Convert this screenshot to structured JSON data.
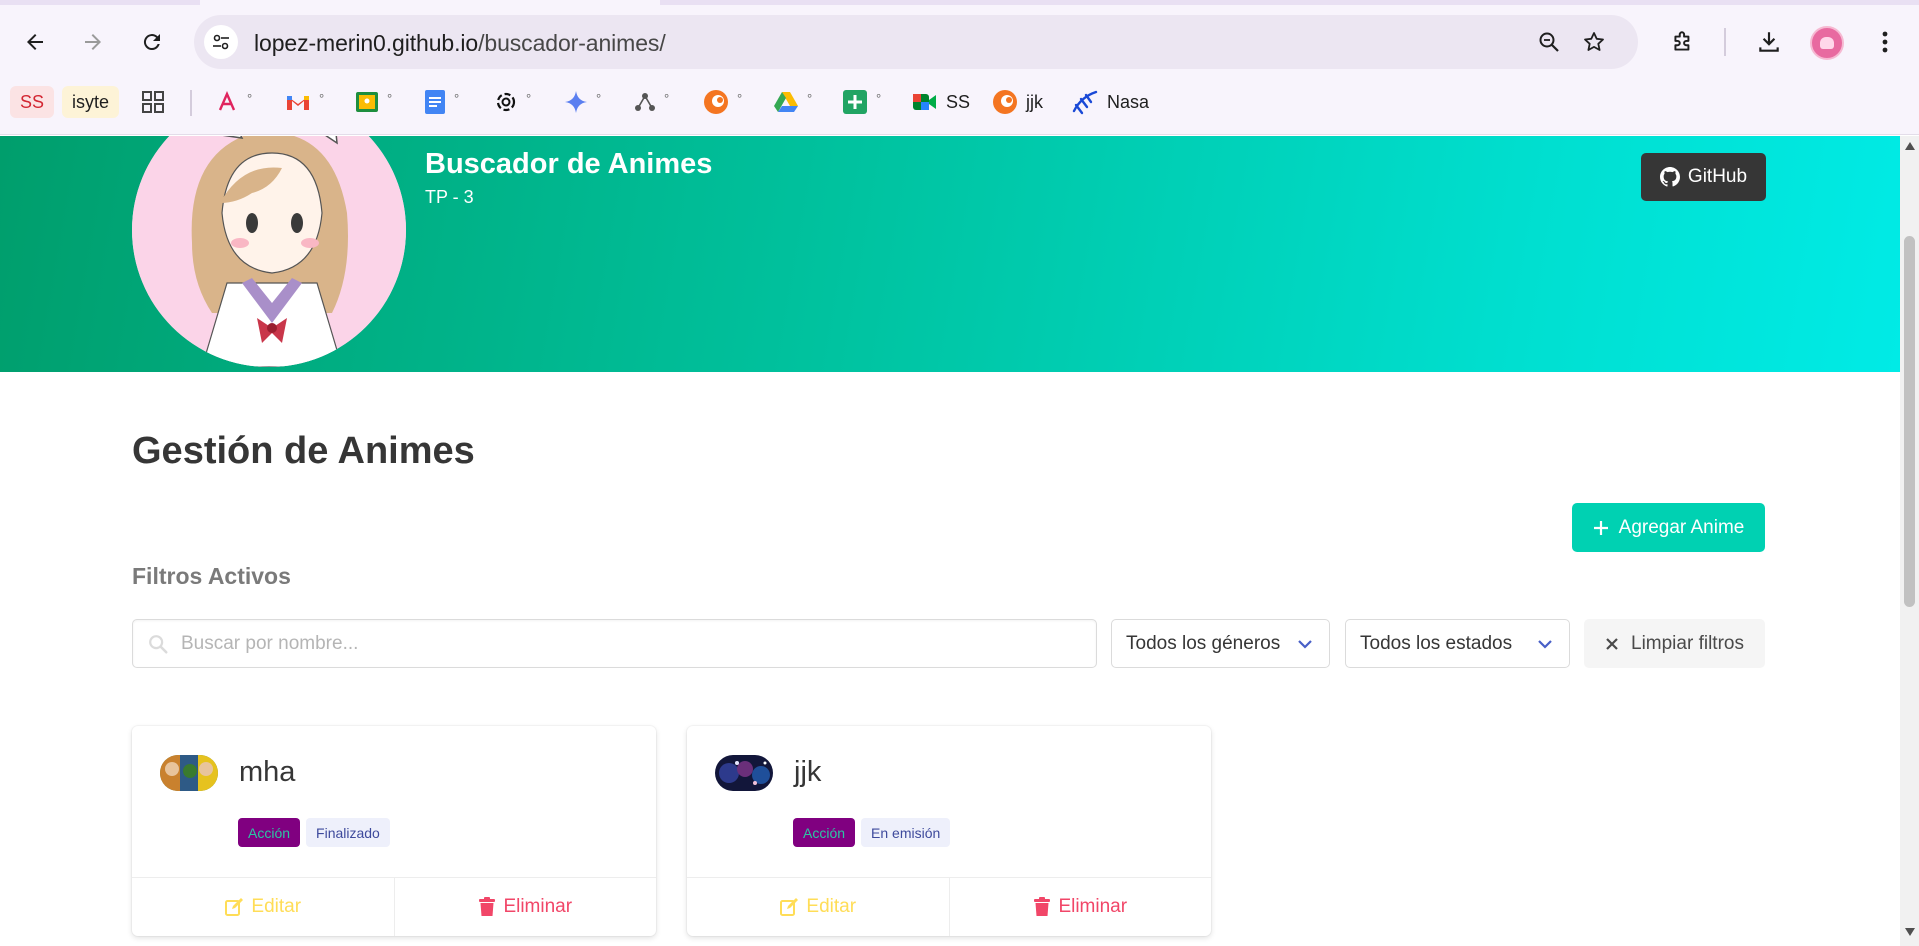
{
  "browser": {
    "url_host": "lopez-merin0.github.io",
    "url_path": "/buscador-animes/",
    "bookmarks": [
      {
        "label": "SS",
        "icon": "ss-chip",
        "color": "#e8323c"
      },
      {
        "label": "isyte",
        "icon": "isyte-chip",
        "color": "#f0a020"
      },
      {
        "label": "",
        "icon": "apps-grid-icon"
      },
      {
        "label": "°",
        "icon": "arc-icon",
        "color": "#e0245e"
      },
      {
        "label": "°",
        "icon": "gmail-icon"
      },
      {
        "label": "°",
        "icon": "classroom-icon"
      },
      {
        "label": "°",
        "icon": "docs-icon"
      },
      {
        "label": "°",
        "icon": "openai-icon"
      },
      {
        "label": "°",
        "icon": "gemini-icon"
      },
      {
        "label": "°",
        "icon": "network-icon"
      },
      {
        "label": "°",
        "icon": "crunchyroll-icon"
      },
      {
        "label": "°",
        "icon": "drive-icon"
      },
      {
        "label": "°",
        "icon": "sheets-icon"
      },
      {
        "label": "SS",
        "icon": "meet-icon"
      },
      {
        "label": "jjk",
        "icon": "crunchyroll-icon"
      },
      {
        "label": "Nasa",
        "icon": "nasa-icon"
      }
    ]
  },
  "hero": {
    "title": "Buscador de Animes",
    "subtitle": "TP - 3",
    "github_label": "GitHub"
  },
  "main": {
    "title": "Gestión de Animes",
    "add_label": "Agregar Anime",
    "filters_label": "Filtros Activos",
    "search_placeholder": "Buscar por nombre...",
    "genre_select": "Todos los géneros",
    "status_select": "Todos los estados",
    "clear_label": "Limpiar filtros"
  },
  "cards": [
    {
      "title": "mha",
      "genre": "Acción",
      "status": "Finalizado",
      "edit_label": "Editar",
      "delete_label": "Eliminar"
    },
    {
      "title": "jjk",
      "genre": "Acción",
      "status": "En emisión",
      "edit_label": "Editar",
      "delete_label": "Eliminar"
    }
  ],
  "colors": {
    "primary": "#00d1b2",
    "dark": "#363636",
    "warning": "#ffdd57",
    "danger": "#f14668",
    "genre_tag": "#800080"
  }
}
